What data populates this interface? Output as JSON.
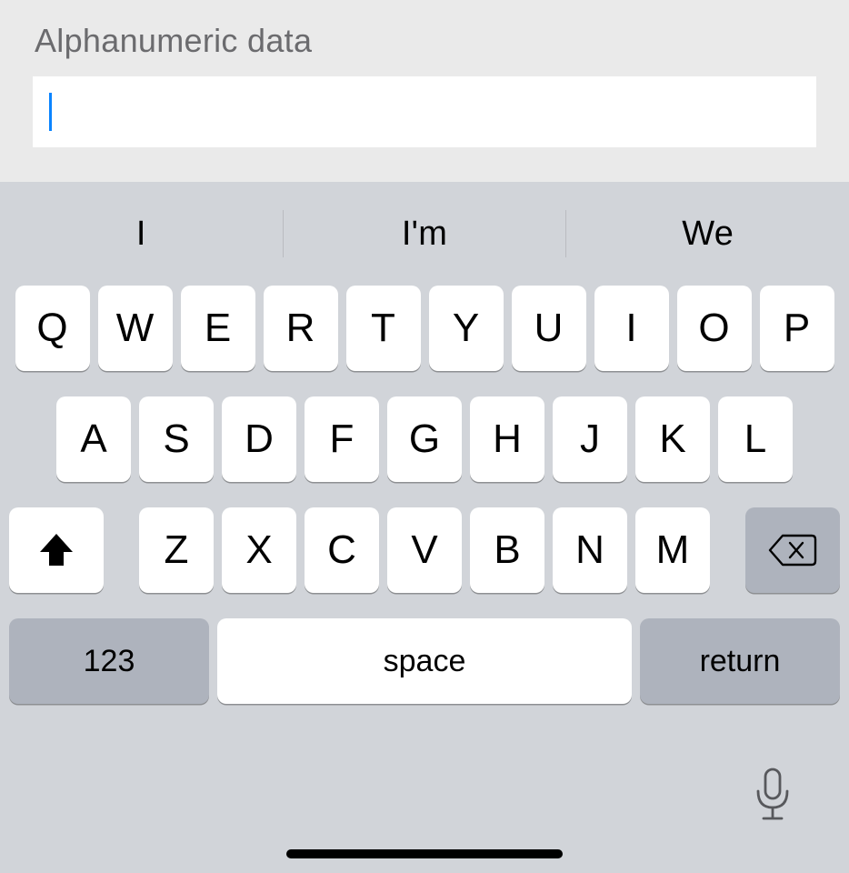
{
  "field": {
    "label": "Alphanumeric data",
    "value": ""
  },
  "suggestions": [
    "I",
    "I'm",
    "We"
  ],
  "keyboard": {
    "row1": [
      "Q",
      "W",
      "E",
      "R",
      "T",
      "Y",
      "U",
      "I",
      "O",
      "P"
    ],
    "row2": [
      "A",
      "S",
      "D",
      "F",
      "G",
      "H",
      "J",
      "K",
      "L"
    ],
    "row3": [
      "Z",
      "X",
      "C",
      "V",
      "B",
      "N",
      "M"
    ],
    "numkey": "123",
    "space": "space",
    "return": "return"
  }
}
